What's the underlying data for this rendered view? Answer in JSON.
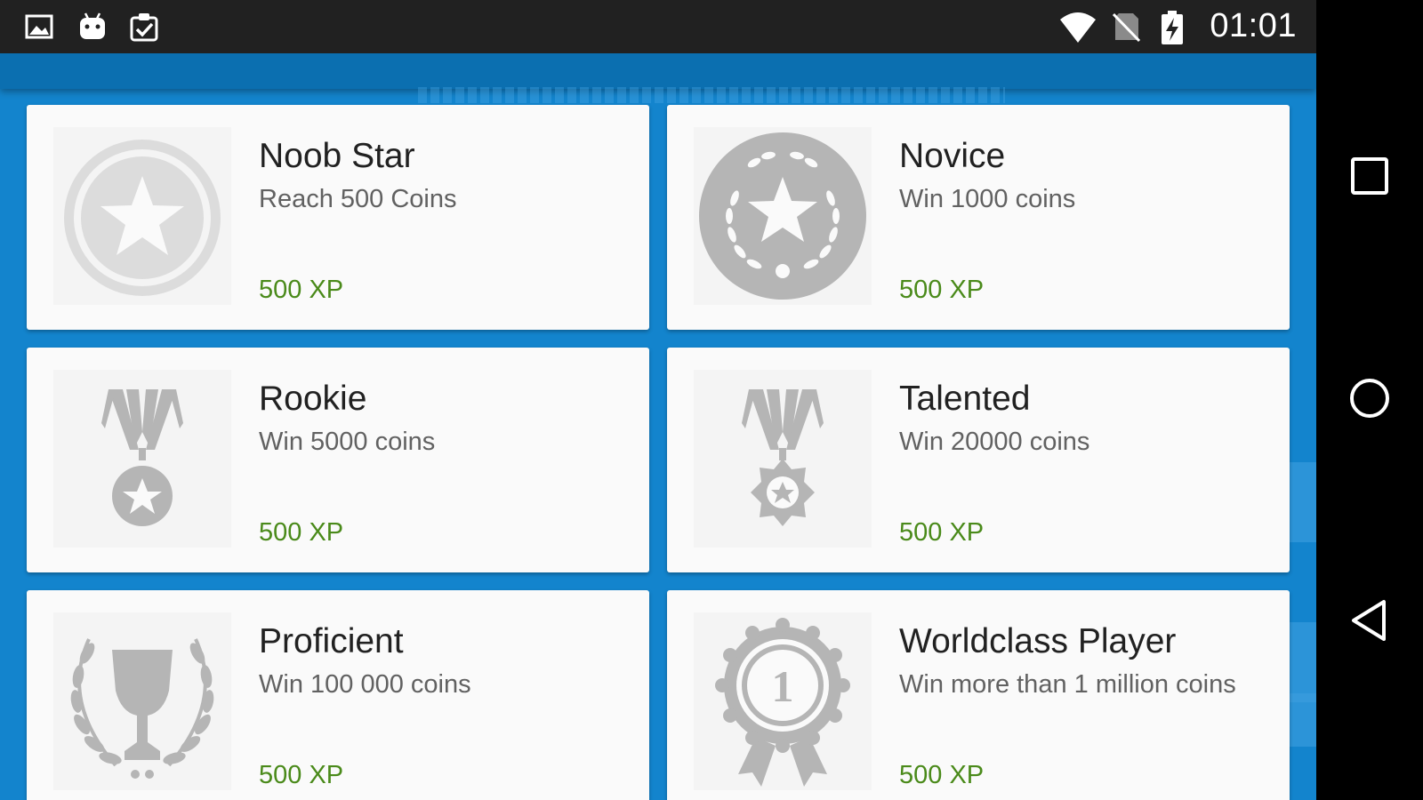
{
  "status_bar": {
    "time": "01:01",
    "left_icons": [
      "image-icon",
      "android-icon",
      "clipboard-check-icon"
    ],
    "right_icons": [
      "wifi-icon",
      "no-sim-icon",
      "battery-charging-icon"
    ]
  },
  "achievements": [
    {
      "title": "Noob Star",
      "description": "Reach 500 Coins",
      "xp": "500 XP",
      "icon": "star-medal-icon"
    },
    {
      "title": "Novice",
      "description": "Win 1000 coins",
      "xp": "500 XP",
      "icon": "laurel-star-medal-icon"
    },
    {
      "title": "Rookie",
      "description": "Win 5000 coins",
      "xp": "500 XP",
      "icon": "ribbon-medal-icon"
    },
    {
      "title": "Talented",
      "description": "Win 20000 coins",
      "xp": "500 XP",
      "icon": "ribbon-star-badge-icon"
    },
    {
      "title": "Proficient",
      "description": "Win 100 000 coins",
      "xp": "500 XP",
      "icon": "trophy-laurel-icon"
    },
    {
      "title": "Worldclass Player",
      "description": "Win more than 1 million coins",
      "xp": "500 XP",
      "icon": "first-place-rosette-icon"
    }
  ],
  "nav_bar": {
    "buttons": [
      "recents-icon",
      "home-icon",
      "back-icon"
    ]
  },
  "colors": {
    "background": "#1384cd",
    "card": "#fafafa",
    "xp": "#4a8a1a",
    "icon_gray": "#b5b5b5"
  }
}
